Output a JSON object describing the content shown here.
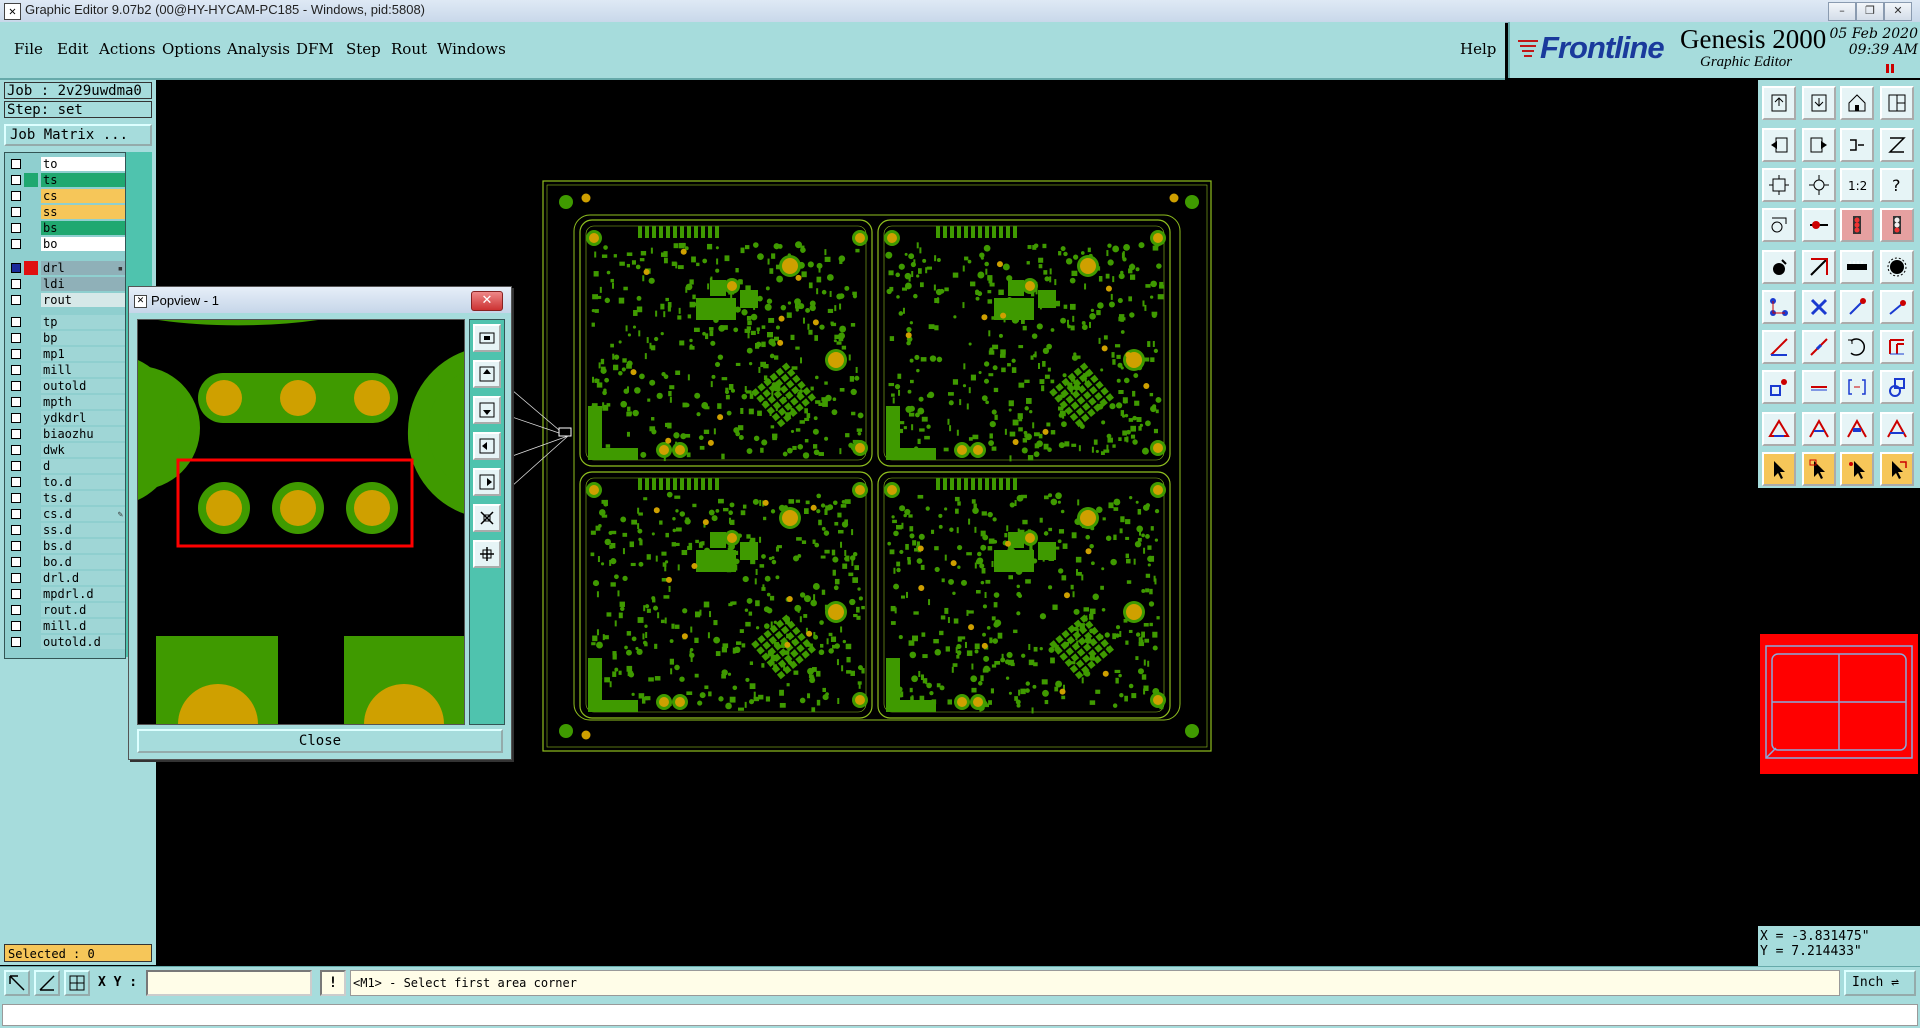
{
  "window": {
    "title": "Graphic Editor 9.07b2 (00@HY-HYCAM-PC185 - Windows, pid:5808)",
    "minimize": "–",
    "restore": "❐",
    "close": "✕"
  },
  "menu": {
    "items": [
      {
        "label": "File"
      },
      {
        "label": "Edit"
      },
      {
        "label": "Actions"
      },
      {
        "label": "Options"
      },
      {
        "label": "Analysis"
      },
      {
        "label": "DFM"
      },
      {
        "label": "Step"
      },
      {
        "label": "Rout"
      },
      {
        "label": "Windows"
      }
    ],
    "help": "Help"
  },
  "brand": {
    "logo_prefix": "F",
    "logo_rest": "rontline",
    "product": "Genesis 2000",
    "subtitle": "Graphic Editor",
    "date": "05 Feb 2020",
    "time": "09:39 AM"
  },
  "job": {
    "job_line": "Job : 2v29uwdma0",
    "step_line": "Step: set",
    "matrix_button": "Job Matrix ..."
  },
  "layers": [
    {
      "name": "to",
      "bg": "#ffffff",
      "swatch": ""
    },
    {
      "name": "ts",
      "bg": "#20a870",
      "swatch": "#20a870"
    },
    {
      "name": "cs",
      "bg": "#f6c659",
      "swatch": ""
    },
    {
      "name": "ss",
      "bg": "#f6c659",
      "swatch": ""
    },
    {
      "name": "bs",
      "bg": "#20a870",
      "swatch": ""
    },
    {
      "name": "bo",
      "bg": "#ffffff",
      "swatch": ""
    },
    {
      "name": "drl",
      "bg": "#8fb0b8",
      "swatch": "#e01010",
      "active": true,
      "marker": "▪"
    },
    {
      "name": "ldi",
      "bg": "#8fb0b8",
      "swatch": ""
    },
    {
      "name": "rout",
      "bg": "#d6e8e8",
      "swatch": ""
    },
    {
      "name": "tp",
      "bg": "#9fd6d6",
      "swatch": ""
    },
    {
      "name": "bp",
      "bg": "#9fd6d6",
      "swatch": ""
    },
    {
      "name": "mp1",
      "bg": "#9fd6d6",
      "swatch": ""
    },
    {
      "name": "mill",
      "bg": "#9fd6d6",
      "swatch": ""
    },
    {
      "name": "outold",
      "bg": "#9fd6d6",
      "swatch": ""
    },
    {
      "name": "mpth",
      "bg": "#9fd6d6",
      "swatch": ""
    },
    {
      "name": "ydkdrl",
      "bg": "#9fd6d6",
      "swatch": ""
    },
    {
      "name": "biaozhu",
      "bg": "#9fd6d6",
      "swatch": ""
    },
    {
      "name": "dwk",
      "bg": "#9fd6d6",
      "swatch": ""
    },
    {
      "name": "d",
      "bg": "#9fd6d6",
      "swatch": ""
    },
    {
      "name": "to.d",
      "bg": "#9fd6d6",
      "swatch": ""
    },
    {
      "name": "ts.d",
      "bg": "#9fd6d6",
      "swatch": ""
    },
    {
      "name": "cs.d",
      "bg": "#9fd6d6",
      "swatch": "",
      "marker": "✎"
    },
    {
      "name": "ss.d",
      "bg": "#9fd6d6",
      "swatch": ""
    },
    {
      "name": "bs.d",
      "bg": "#9fd6d6",
      "swatch": ""
    },
    {
      "name": "bo.d",
      "bg": "#9fd6d6",
      "swatch": ""
    },
    {
      "name": "drl.d",
      "bg": "#9fd6d6",
      "swatch": ""
    },
    {
      "name": "mpdrl.d",
      "bg": "#9fd6d6",
      "swatch": ""
    },
    {
      "name": "rout.d",
      "bg": "#9fd6d6",
      "swatch": ""
    },
    {
      "name": "mill.d",
      "bg": "#9fd6d6",
      "swatch": ""
    },
    {
      "name": "outold.d",
      "bg": "#9fd6d6",
      "swatch": ""
    }
  ],
  "status": {
    "selected": "Selected : 0",
    "x": "X = -3.831475\"",
    "y": "Y = 7.214433\""
  },
  "bottom": {
    "xy_label": "X Y :",
    "xy_value": "",
    "info_button": "!",
    "prompt": "<M1> - Select first area corner",
    "unit": "Inch ⇌"
  },
  "popview": {
    "title": "Popview - 1",
    "close": "Close",
    "close_x": "✕"
  },
  "colors": {
    "panel": "#a6dcdc",
    "copper": "#3f9a00",
    "pad": "#cfa000",
    "outline": "#8fbf1f",
    "highlight": "#ff0000"
  },
  "icons": {
    "toolbar": [
      "open-icon",
      "save-icon",
      "home-icon",
      "layout-icon",
      "move-left-icon",
      "move-right-icon",
      "connect-icon",
      "grid-icon",
      "fit-icon",
      "center-icon",
      "scale-icon",
      "help-icon",
      "measure-icon",
      "probe-icon",
      "traffic-red-icon",
      "traffic-icon",
      "snap-icon",
      "corner-icon",
      "ruler-icon",
      "target-icon",
      "net-icon",
      "cross-icon",
      "line-node-icon",
      "line-end-icon",
      "draw-line-icon",
      "draw-line2-icon",
      "arc-icon",
      "column-icon",
      "pad-icon",
      "segment-icon",
      "bracket-icon",
      "shape-icon",
      "triangle-icon",
      "triangle-filled-icon",
      "triangle-cut-icon",
      "triangle-cut2-icon",
      "pointer-icon",
      "pointer-select-icon",
      "pointer-alt-icon",
      "pointer-drag-icon"
    ]
  }
}
